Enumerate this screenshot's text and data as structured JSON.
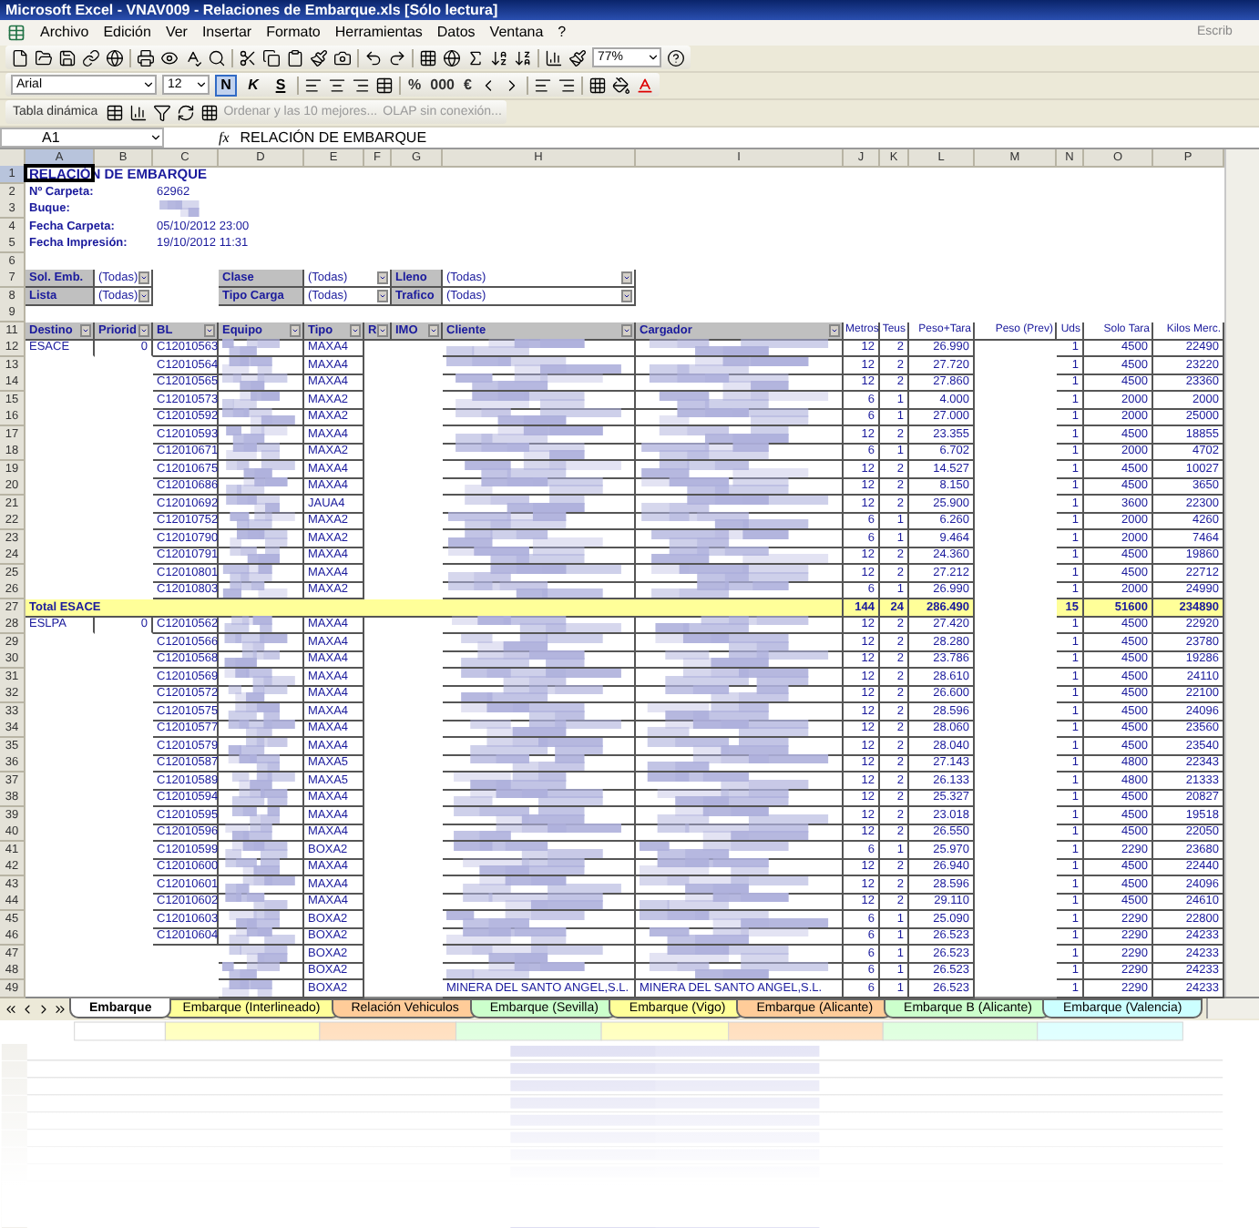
{
  "window": {
    "title": "Microsoft Excel - VNAV009 - Relaciones de Embarque.xls  [Sólo lectura]"
  },
  "menu": [
    "Archivo",
    "Edición",
    "Ver",
    "Insertar",
    "Formato",
    "Herramientas",
    "Datos",
    "Ventana",
    "?"
  ],
  "help_box": {
    "placeholder": "Escrib"
  },
  "standard_toolbar": {
    "zoom": "77%"
  },
  "format_toolbar": {
    "font": "Arial",
    "size": "12",
    "styles": [
      {
        "label": "N",
        "on": true
      },
      {
        "label": "K",
        "on": false
      },
      {
        "label": "S",
        "on": false
      }
    ],
    "number_buttons": [
      "%",
      "000",
      "€"
    ]
  },
  "pivot_toolbar": {
    "menu": "Tabla dinámica",
    "items": [
      "Ordenar y las 10 mejores...",
      "OLAP sin conexión..."
    ]
  },
  "formula_bar": {
    "name_box": "A1",
    "fx": "fx",
    "formula": "RELACIÓN DE EMBARQUE"
  },
  "columns": [
    "A",
    "B",
    "C",
    "D",
    "E",
    "F",
    "G",
    "H",
    "I",
    "J",
    "K",
    "L",
    "M",
    "N",
    "O",
    "P"
  ],
  "title": {
    "row": "1",
    "text": "RELACIÓN DE EMBARQUE"
  },
  "info": [
    {
      "row": "2",
      "label": "Nº Carpeta:",
      "value": "62962"
    },
    {
      "row": "3",
      "label": "Buque:"
    },
    {
      "row": "4",
      "label": "Fecha Carpeta:",
      "value": "05/10/2012 23:00"
    },
    {
      "row": "5",
      "label": "Fecha Impresión:",
      "value": "19/10/2012 11:31"
    }
  ],
  "blank_rows": [
    "6",
    "9"
  ],
  "filters": [
    {
      "row": "7",
      "items": [
        {
          "label": "Sol. Emb.",
          "value": "(Todas)"
        },
        {
          "label": "Clase",
          "value": "(Todas)"
        },
        {
          "label": "Lleno",
          "value": "(Todas)"
        }
      ]
    },
    {
      "row": "8",
      "items": [
        {
          "label": "Lista",
          "value": "(Todas)"
        },
        {
          "label": "Tipo Carga",
          "value": "(Todas)"
        },
        {
          "label": "Trafico",
          "value": "(Todas)"
        }
      ]
    }
  ],
  "header": {
    "row": "11",
    "filter_columns": [
      "Destino",
      "Priorid",
      "BL",
      "Equipo",
      "Tipo",
      "R",
      "IMO",
      "Cliente",
      "Cargador"
    ],
    "value_columns": [
      "Metros",
      "Teus",
      "Peso+Tara",
      "Peso (Prev)",
      "Uds",
      "Solo Tara",
      "Kilos Merc."
    ]
  },
  "groups": [
    {
      "destino": "ESACE",
      "priorid": "0",
      "rows": [
        {
          "row": "12",
          "bl": "C12010563",
          "tipo": "MAXA4",
          "metros": "12",
          "teus": "2",
          "peso_tara": "26.990",
          "uds": "1",
          "solo_tara": "4500",
          "kilos": "22490"
        },
        {
          "row": "13",
          "bl": "C12010564",
          "tipo": "MAXA4",
          "metros": "12",
          "teus": "2",
          "peso_tara": "27.720",
          "uds": "1",
          "solo_tara": "4500",
          "kilos": "23220"
        },
        {
          "row": "14",
          "bl": "C12010565",
          "tipo": "MAXA4",
          "metros": "12",
          "teus": "2",
          "peso_tara": "27.860",
          "uds": "1",
          "solo_tara": "4500",
          "kilos": "23360"
        },
        {
          "row": "15",
          "bl": "C12010573",
          "tipo": "MAXA2",
          "metros": "6",
          "teus": "1",
          "peso_tara": "4.000",
          "uds": "1",
          "solo_tara": "2000",
          "kilos": "2000"
        },
        {
          "row": "16",
          "bl": "C12010592",
          "tipo": "MAXA2",
          "metros": "6",
          "teus": "1",
          "peso_tara": "27.000",
          "uds": "1",
          "solo_tara": "2000",
          "kilos": "25000"
        },
        {
          "row": "17",
          "bl": "C12010593",
          "tipo": "MAXA4",
          "metros": "12",
          "teus": "2",
          "peso_tara": "23.355",
          "uds": "1",
          "solo_tara": "4500",
          "kilos": "18855"
        },
        {
          "row": "18",
          "bl": "C12010671",
          "tipo": "MAXA2",
          "metros": "6",
          "teus": "1",
          "peso_tara": "6.702",
          "uds": "1",
          "solo_tara": "2000",
          "kilos": "4702"
        },
        {
          "row": "19",
          "bl": "C12010675",
          "tipo": "MAXA4",
          "metros": "12",
          "teus": "2",
          "peso_tara": "14.527",
          "uds": "1",
          "solo_tara": "4500",
          "kilos": "10027"
        },
        {
          "row": "20",
          "bl": "C12010686",
          "tipo": "MAXA4",
          "metros": "12",
          "teus": "2",
          "peso_tara": "8.150",
          "uds": "1",
          "solo_tara": "4500",
          "kilos": "3650"
        },
        {
          "row": "21",
          "bl": "C12010692",
          "tipo": "JAUA4",
          "metros": "12",
          "teus": "2",
          "peso_tara": "25.900",
          "uds": "1",
          "solo_tara": "3600",
          "kilos": "22300"
        },
        {
          "row": "22",
          "bl": "C12010752",
          "tipo": "MAXA2",
          "metros": "6",
          "teus": "1",
          "peso_tara": "6.260",
          "uds": "1",
          "solo_tara": "2000",
          "kilos": "4260"
        },
        {
          "row": "23",
          "bl": "C12010790",
          "tipo": "MAXA2",
          "metros": "6",
          "teus": "1",
          "peso_tara": "9.464",
          "uds": "1",
          "solo_tara": "2000",
          "kilos": "7464"
        },
        {
          "row": "24",
          "bl": "C12010791",
          "tipo": "MAXA4",
          "metros": "12",
          "teus": "2",
          "peso_tara": "24.360",
          "uds": "1",
          "solo_tara": "4500",
          "kilos": "19860"
        },
        {
          "row": "25",
          "bl": "C12010801",
          "tipo": "MAXA4",
          "metros": "12",
          "teus": "2",
          "peso_tara": "27.212",
          "uds": "1",
          "solo_tara": "4500",
          "kilos": "22712"
        },
        {
          "row": "26",
          "bl": "C12010803",
          "tipo": "MAXA2",
          "metros": "6",
          "teus": "1",
          "peso_tara": "26.990",
          "uds": "1",
          "solo_tara": "2000",
          "kilos": "24990"
        }
      ],
      "total": {
        "row": "27",
        "label": "Total ESACE",
        "metros": "144",
        "teus": "24",
        "peso_tara": "286.490",
        "uds": "15",
        "solo_tara": "51600",
        "kilos": "234890"
      }
    },
    {
      "destino": "ESLPA",
      "priorid": "0",
      "rows": [
        {
          "row": "28",
          "bl": "C12010562",
          "tipo": "MAXA4",
          "metros": "12",
          "teus": "2",
          "peso_tara": "27.420",
          "uds": "1",
          "solo_tara": "4500",
          "kilos": "22920"
        },
        {
          "row": "29",
          "bl": "C12010566",
          "tipo": "MAXA4",
          "metros": "12",
          "teus": "2",
          "peso_tara": "28.280",
          "uds": "1",
          "solo_tara": "4500",
          "kilos": "23780"
        },
        {
          "row": "30",
          "bl": "C12010568",
          "tipo": "MAXA4",
          "metros": "12",
          "teus": "2",
          "peso_tara": "23.786",
          "uds": "1",
          "solo_tara": "4500",
          "kilos": "19286"
        },
        {
          "row": "31",
          "bl": "C12010569",
          "tipo": "MAXA4",
          "metros": "12",
          "teus": "2",
          "peso_tara": "28.610",
          "uds": "1",
          "solo_tara": "4500",
          "kilos": "24110"
        },
        {
          "row": "32",
          "bl": "C12010572",
          "tipo": "MAXA4",
          "metros": "12",
          "teus": "2",
          "peso_tara": "26.600",
          "uds": "1",
          "solo_tara": "4500",
          "kilos": "22100"
        },
        {
          "row": "33",
          "bl": "C12010575",
          "tipo": "MAXA4",
          "metros": "12",
          "teus": "2",
          "peso_tara": "28.596",
          "uds": "1",
          "solo_tara": "4500",
          "kilos": "24096"
        },
        {
          "row": "34",
          "bl": "C12010577",
          "tipo": "MAXA4",
          "metros": "12",
          "teus": "2",
          "peso_tara": "28.060",
          "uds": "1",
          "solo_tara": "4500",
          "kilos": "23560"
        },
        {
          "row": "35",
          "bl": "C12010579",
          "tipo": "MAXA4",
          "metros": "12",
          "teus": "2",
          "peso_tara": "28.040",
          "uds": "1",
          "solo_tara": "4500",
          "kilos": "23540"
        },
        {
          "row": "36",
          "bl": "C12010587",
          "tipo": "MAXA5",
          "metros": "12",
          "teus": "2",
          "peso_tara": "27.143",
          "uds": "1",
          "solo_tara": "4800",
          "kilos": "22343"
        },
        {
          "row": "37",
          "bl": "C12010589",
          "tipo": "MAXA5",
          "metros": "12",
          "teus": "2",
          "peso_tara": "26.133",
          "uds": "1",
          "solo_tara": "4800",
          "kilos": "21333"
        },
        {
          "row": "38",
          "bl": "C12010594",
          "tipo": "MAXA4",
          "metros": "12",
          "teus": "2",
          "peso_tara": "25.327",
          "uds": "1",
          "solo_tara": "4500",
          "kilos": "20827"
        },
        {
          "row": "39",
          "bl": "C12010595",
          "tipo": "MAXA4",
          "metros": "12",
          "teus": "2",
          "peso_tara": "23.018",
          "uds": "1",
          "solo_tara": "4500",
          "kilos": "19518"
        },
        {
          "row": "40",
          "bl": "C12010596",
          "tipo": "MAXA4",
          "metros": "12",
          "teus": "2",
          "peso_tara": "26.550",
          "uds": "1",
          "solo_tara": "4500",
          "kilos": "22050"
        },
        {
          "row": "41",
          "bl": "C12010599",
          "tipo": "BOXA2",
          "metros": "6",
          "teus": "1",
          "peso_tara": "25.970",
          "uds": "1",
          "solo_tara": "2290",
          "kilos": "23680"
        },
        {
          "row": "42",
          "bl": "C12010600",
          "tipo": "MAXA4",
          "metros": "12",
          "teus": "2",
          "peso_tara": "26.940",
          "uds": "1",
          "solo_tara": "4500",
          "kilos": "22440"
        },
        {
          "row": "43",
          "bl": "C12010601",
          "tipo": "MAXA4",
          "metros": "12",
          "teus": "2",
          "peso_tara": "28.596",
          "uds": "1",
          "solo_tara": "4500",
          "kilos": "24096"
        },
        {
          "row": "44",
          "bl": "C12010602",
          "tipo": "MAXA4",
          "metros": "12",
          "teus": "2",
          "peso_tara": "29.110",
          "uds": "1",
          "solo_tara": "4500",
          "kilos": "24610"
        },
        {
          "row": "45",
          "bl": "C12010603",
          "tipo": "BOXA2",
          "metros": "6",
          "teus": "1",
          "peso_tara": "25.090",
          "uds": "1",
          "solo_tara": "2290",
          "kilos": "22800"
        },
        {
          "row": "46",
          "bl": "C12010604",
          "tipo": "BOXA2",
          "metros": "6",
          "teus": "1",
          "peso_tara": "26.523",
          "uds": "1",
          "solo_tara": "2290",
          "kilos": "24233"
        },
        {
          "row": "47",
          "tipo": "BOXA2",
          "metros": "6",
          "teus": "1",
          "peso_tara": "26.523",
          "uds": "1",
          "solo_tara": "2290",
          "kilos": "24233"
        },
        {
          "row": "48",
          "tipo": "BOXA2",
          "metros": "6",
          "teus": "1",
          "peso_tara": "26.523",
          "uds": "1",
          "solo_tara": "2290",
          "kilos": "24233"
        },
        {
          "row": "49",
          "tipo": "BOXA2",
          "cliente": "MINERA DEL SANTO ANGEL,S.L.",
          "cargador": "MINERA DEL SANTO ANGEL,S.L.",
          "metros": "6",
          "teus": "1",
          "peso_tara": "26.523",
          "uds": "1",
          "solo_tara": "2290",
          "kilos": "24233"
        }
      ]
    }
  ],
  "sheet_tabs": [
    {
      "label": "Embarque",
      "selected": true,
      "color": "#ffffff"
    },
    {
      "label": "Embarque (Interlineado)",
      "selected": false,
      "color": "#ffff99"
    },
    {
      "label": "Relación Vehiculos",
      "selected": false,
      "color": "#ffcc99"
    },
    {
      "label": "Embarque (Sevilla)",
      "selected": false,
      "color": "#ccffcc"
    },
    {
      "label": "Embarque (Vigo)",
      "selected": false,
      "color": "#ffff99"
    },
    {
      "label": "Embarque (Alicante)",
      "selected": false,
      "color": "#ffcc99"
    },
    {
      "label": "Embarque B (Alicante)",
      "selected": false,
      "color": "#ccffcc"
    },
    {
      "label": "Embarque (Valencia)",
      "selected": false,
      "color": "#ccffff"
    }
  ]
}
